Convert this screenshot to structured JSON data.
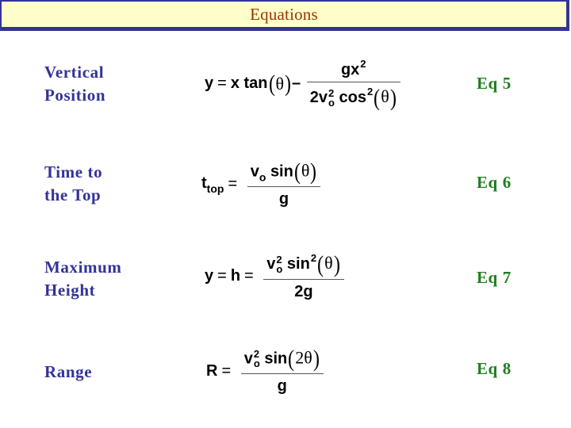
{
  "header": {
    "title": "Equations"
  },
  "rows": [
    {
      "label_line1": "Vertical",
      "label_line2": "Position",
      "equation_id": "Eq",
      "equation_num": "5",
      "equation": {
        "lhs": "y",
        "eq": "=",
        "term1_coef": "x",
        "term1_func": "tan",
        "theta": "θ",
        "minus": "–",
        "numer_base": "gx",
        "numer_exp": "2",
        "denom_coef": "2v",
        "denom_v_exp": "2",
        "denom_v_sub": "o",
        "denom_func": "cos",
        "denom_func_exp": "2",
        "open_paren": "(",
        "close_paren": ")"
      }
    },
    {
      "label_line1": "Time to",
      "label_line2": "the Top",
      "equation_id": "Eq",
      "equation_num": "6",
      "equation": {
        "lhs": "t",
        "lhs_sub": "top",
        "eq": "=",
        "numer_v": "v",
        "numer_v_sub": "o",
        "numer_func": "sin",
        "theta": "θ",
        "denom": "g",
        "open_paren": "(",
        "close_paren": ")"
      }
    },
    {
      "label_line1": "Maximum",
      "label_line2": "Height",
      "equation_id": "Eq",
      "equation_num": "7",
      "equation": {
        "lhs1": "y",
        "eq1": "=",
        "lhs2": "h",
        "eq2": "=",
        "numer_v": "v",
        "numer_v_exp": "2",
        "numer_v_sub": "o",
        "numer_func": "sin",
        "numer_func_exp": "2",
        "theta": "θ",
        "denom": "2g",
        "open_paren": "(",
        "close_paren": ")"
      }
    },
    {
      "label_line1": "Range",
      "label_line2": "",
      "equation_id": "Eq",
      "equation_num": "8",
      "equation": {
        "lhs": "R",
        "eq": "=",
        "numer_v": "v",
        "numer_v_exp": "2",
        "numer_v_sub": "o",
        "numer_func": "sin",
        "arg": "2θ",
        "denom": "g",
        "open_paren": "(",
        "close_paren": ")"
      }
    }
  ],
  "colors": {
    "banner_fill": "#FFFFCC",
    "banner_border": "#333399",
    "title_text": "#993300",
    "label_text": "#333399",
    "eq_number_text": "#1E7F1E",
    "math_text": "#000000"
  }
}
